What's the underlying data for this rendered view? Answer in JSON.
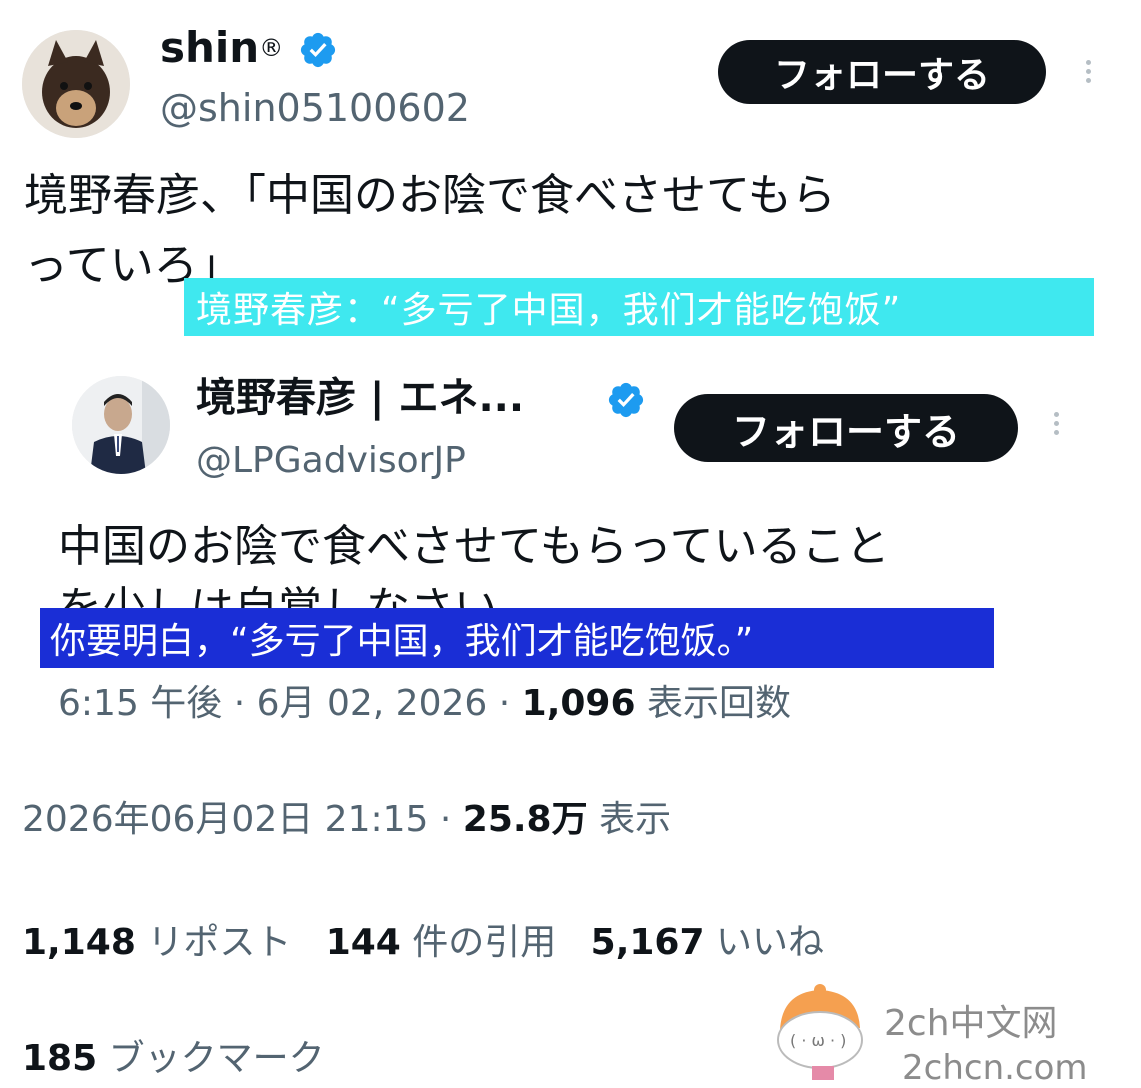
{
  "outer_tweet": {
    "display_name": "shin",
    "name_badge": "®",
    "handle": "@shin05100602",
    "follow_label": "フォローする",
    "text_line1": "境野春彦、「中国のお陰で食べさせてもら",
    "text_line2": "っていろ」",
    "subtitle_cn": "境野春彦：“多亏了中国，我们才能吃饱饭”"
  },
  "quoted_tweet": {
    "display_name": "境野春彦 | エネ...",
    "handle": "@LPGadvisorJP",
    "follow_label": "フォローする",
    "text_line1": "中国のお陰で食べさせてもらっていること",
    "text_line2": "を少しは自覚しなさい",
    "subtitle_cn": "你要明白，“多亏了中国，我们才能吃饱饭。”",
    "time": "6:15 午後",
    "date": "6月 02, 2026",
    "views_count": "1,096",
    "views_label": "表示回数"
  },
  "outer_meta": {
    "datetime": "2026年06月02日 21:15",
    "views_count": "25.8万",
    "views_label": "表示"
  },
  "stats": {
    "reposts_count": "1,148",
    "reposts_label": "リポスト",
    "quotes_count": "144",
    "quotes_label": "件の引用",
    "likes_count": "5,167",
    "likes_label": "いいね",
    "bookmarks_count": "185",
    "bookmarks_label": "ブックマーク"
  },
  "watermark": {
    "line1": "2ch中文网",
    "line2": "2chcn.com"
  },
  "colors": {
    "verified": "#1d9bf0",
    "cyan_overlay": "#3fe8ef",
    "blue_overlay": "#1a2ed6",
    "follow_button": "#0f1419"
  },
  "icons": [
    "verified-badge-icon",
    "kebab-menu-icon",
    "user-avatar",
    "mascot-icon"
  ]
}
